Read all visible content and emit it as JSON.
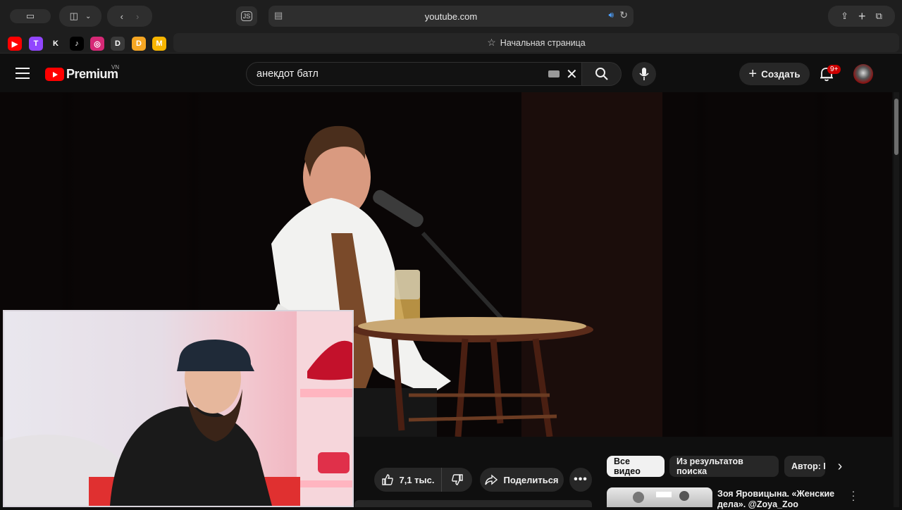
{
  "browser": {
    "url": "youtube.com",
    "js_badge": "JS",
    "start_page": "Начальная страница"
  },
  "bookmarks": [
    {
      "name": "youtube",
      "color": "#ff0000",
      "glyph": "▶"
    },
    {
      "name": "twitch",
      "color": "#9146ff",
      "glyph": "T"
    },
    {
      "name": "kick",
      "color": "#1e1e1e",
      "glyph": "K"
    },
    {
      "name": "tiktok",
      "color": "#000000",
      "glyph": "♪"
    },
    {
      "name": "instagram",
      "color": "#d62976",
      "glyph": "◎"
    },
    {
      "name": "dl",
      "color": "#3a3a3a",
      "glyph": "D"
    },
    {
      "name": "donation",
      "color": "#f5a623",
      "glyph": "D"
    },
    {
      "name": "m",
      "color": "#f7b500",
      "glyph": "M"
    }
  ],
  "youtube": {
    "logo_text": "Premium",
    "region": "VN",
    "search_value": "анекдот батл",
    "create_label": "Создать",
    "notifications": "9+"
  },
  "actions": {
    "likes": "7,1 тыс.",
    "share": "Поделиться"
  },
  "chips": [
    "Все видео",
    "Из результатов поиска",
    "Автор: К"
  ],
  "recommendation": {
    "title_line1": "Зоя Яровицына. «Женские",
    "title_line2": "дела». @Zoya_Zoo"
  }
}
